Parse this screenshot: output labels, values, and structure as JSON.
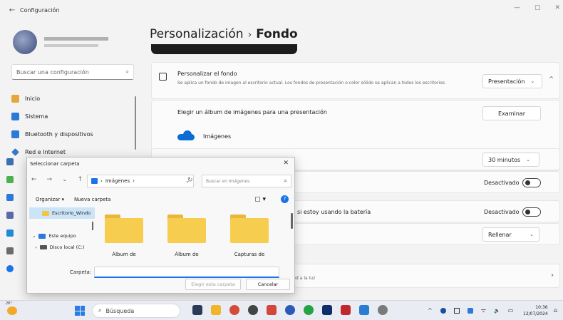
{
  "window": {
    "back_glyph": "←",
    "title": "Configuración",
    "minimize_glyph": "—",
    "maximize_glyph": "▢",
    "close_glyph": "✕"
  },
  "sidebar": {
    "search_placeholder": "Buscar una configuración",
    "search_icon_glyph": "⌕",
    "items": [
      {
        "label": "Inicio",
        "icon": "home-icon",
        "color": "#e5a73a"
      },
      {
        "label": "Sistema",
        "icon": "system-icon",
        "color": "#2b79d8"
      },
      {
        "label": "Bluetooth y dispositivos",
        "icon": "bluetooth-icon",
        "color": "#2b79d8"
      },
      {
        "label": "Red e Internet",
        "icon": "network-icon",
        "color": "#3a78c4"
      }
    ]
  },
  "main": {
    "breadcrumb_parent": "Personalización",
    "breadcrumb_sep": "›",
    "breadcrumb_current": "Fondo",
    "personalize": {
      "title": "Personalizar el fondo",
      "description": "Se aplica un fondo de imagen al escritorio actual. Los fondos de presentación o color sólido se aplican a todos los escritorios.",
      "dropdown_value": "Presentación",
      "dropdown_chevron": "⌄",
      "collapse_glyph": "^"
    },
    "album": {
      "title": "Elegir un álbum de imágenes para una presentación",
      "browse_button": "Examinar",
      "album_name": "Imágenes"
    },
    "rows": {
      "interval_value": "30 minutos",
      "shuffle_value": "Desactivado",
      "battery_label": "si estoy usando la batería",
      "battery_value": "Desactivado",
      "fit_value": "Rellenar"
    },
    "last_card": {
      "subtitle": "ted a la luz",
      "chevron": "›"
    }
  },
  "dialog": {
    "title": "Seleccionar carpeta",
    "close_glyph": "✕",
    "nav_back": "←",
    "nav_forward": "→",
    "nav_down": "⌄",
    "nav_up": "↑",
    "address_location": "Imágenes",
    "address_sep": "›",
    "address_chevron": "⌄",
    "refresh_glyph": "↻",
    "search_placeholder": "Buscar en Imágenes",
    "search_glyph": "⌕",
    "organize_label": "Organizar ▾",
    "new_folder_label": "Nueva carpeta",
    "view_glyph": "▢ ▾",
    "help_glyph": "?",
    "tree": [
      {
        "label": "Escritorio_Windo",
        "type": "folder",
        "selected": true
      },
      {
        "label": "Este equipo",
        "type": "pc",
        "selected": false
      },
      {
        "label": "Disco local (C:)",
        "type": "disk",
        "selected": false
      }
    ],
    "tree_expand_open": "⌄",
    "tree_expand_closed": "›",
    "files": [
      {
        "label": "Álbum de"
      },
      {
        "label": "Álbum de"
      },
      {
        "label": "Capturas de"
      }
    ],
    "folder_label": "Carpeta:",
    "select_button": "Elegir esta carpeta",
    "cancel_button": "Cancelar"
  },
  "taskbar": {
    "weather_temp": "26°",
    "search_label": "Búsqueda",
    "search_glyph": "⌕",
    "tray_chevron": "^",
    "wifi_glyph": "ᯤ",
    "volume_glyph": "🔈",
    "battery_glyph": "▭",
    "time": "10:36",
    "date": "12/07/2024",
    "notification_glyph": "⌂",
    "app_colors": [
      "#2b3a55",
      "#f1b52c",
      "#d24c38",
      "#444444",
      "#d2463b",
      "#2a5ab8",
      "#25a244",
      "#0f2d6b",
      "#c1272d",
      "#2b7cd3",
      "#7a7a7a"
    ]
  }
}
